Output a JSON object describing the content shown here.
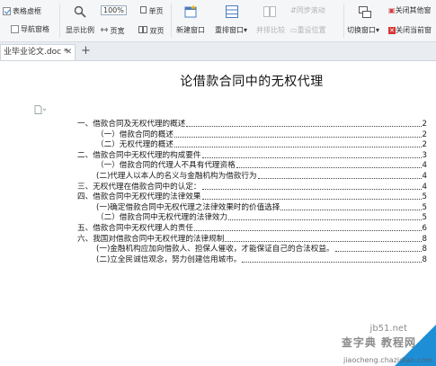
{
  "ribbon": {
    "table_bounds_label": "表格虚框",
    "table_bounds_checked": true,
    "nav_pane_label": "导航窗格",
    "nav_pane_checked": false,
    "show_ratio_label": "显示比例",
    "zoom_value": "100%",
    "single_page_label": "单页",
    "page_width_label": "页宽",
    "two_page_label": "双页",
    "new_window_label": "新建窗口",
    "arrange_window_label": "重排窗口",
    "side_by_side_label": "并排比较",
    "sync_scroll_label": "同步滚动",
    "reset_position_label": "重设位置",
    "switch_window_label": "切换窗口",
    "close_others_label": "关闭其他窗",
    "close_current_label": "关闭当前窗"
  },
  "tabs": [
    {
      "label": "业毕业论文.doc *"
    }
  ],
  "document": {
    "title": "论借款合同中的无权代理",
    "toc": [
      {
        "label": "一、借款合同及无权代理的概述",
        "page": "2",
        "level": 1
      },
      {
        "label": "（一）借款合同的概述",
        "page": "2",
        "level": 2
      },
      {
        "label": "（二）无权代理的概述",
        "page": "2",
        "level": 2
      },
      {
        "label": "二、借款合同中无权代理的构成要件",
        "page": "3",
        "level": 1
      },
      {
        "label": "（一）借款合同的代理人不具有代理资格",
        "page": "4",
        "level": 2
      },
      {
        "label": "(二)代理人以本人的名义与金融机构为借款行为",
        "page": "4",
        "level": 2
      },
      {
        "label": "三、无权代理在借款合同中的认定：",
        "page": "4",
        "level": 1
      },
      {
        "label": "四、借款合同中无权代理的法律效果",
        "page": "5",
        "level": 1
      },
      {
        "label": "(一)确定借款合同中无权代理之法律效果时的价值选择",
        "page": "5",
        "level": 2
      },
      {
        "label": "（二）借款合同中无权代理的法律效力",
        "page": "5",
        "level": 2
      },
      {
        "label": "五、借款合同中无权代理人的责任",
        "page": "6",
        "level": 1
      },
      {
        "label": "六、我国对借款合同中无权代理的法律规制",
        "page": "8",
        "level": 1
      },
      {
        "label": "(一)金融机构应加向借款人、担保人催收，才能保证自己的合法权益。",
        "page": "8",
        "level": 2
      },
      {
        "label": "(二)立全民诚信观念，努力创建信用城市。",
        "page": "8",
        "level": 2
      }
    ]
  },
  "watermark": {
    "site": "jb51.net",
    "text": "查字典 教程网",
    "url": "jiaocheng.chazidian.com"
  }
}
